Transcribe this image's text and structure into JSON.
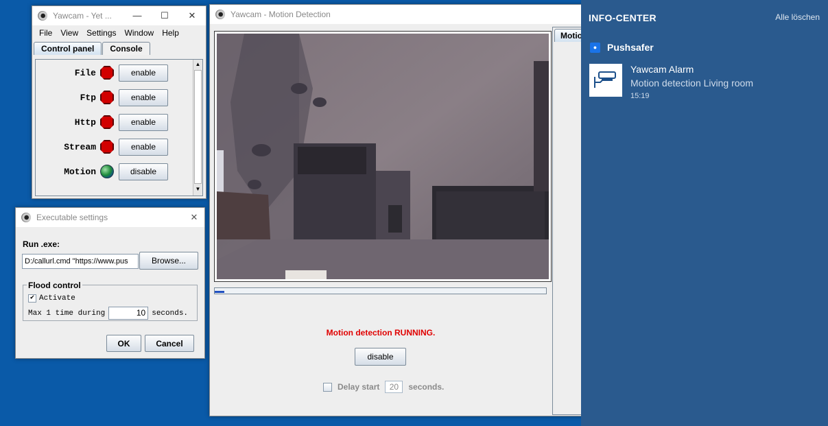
{
  "control_window": {
    "title": "Yawcam - Yet ...",
    "menu": [
      "File",
      "View",
      "Settings",
      "Window",
      "Help"
    ],
    "tabs": [
      "Control panel",
      "Console"
    ],
    "rows": [
      {
        "label": "File",
        "button": "enable",
        "status": "stop-icon"
      },
      {
        "label": "Ftp",
        "button": "enable",
        "status": "stop-icon"
      },
      {
        "label": "Http",
        "button": "enable",
        "status": "stop-icon"
      },
      {
        "label": "Stream",
        "button": "enable",
        "status": "stop-icon"
      },
      {
        "label": "Motion",
        "button": "disable",
        "status": "globe-icon"
      }
    ]
  },
  "exec_window": {
    "title": "Executable settings",
    "run_label": "Run .exe:",
    "run_value": "D:/callurl.cmd \"https://www.pus",
    "browse": "Browse...",
    "flood_title": "Flood control",
    "activate": "Activate",
    "max_prefix": "Max 1 time during",
    "max_value": "10",
    "max_suffix": "seconds.",
    "ok": "OK",
    "cancel": "Cancel"
  },
  "motion_window": {
    "title": "Yawcam - Motion Detection",
    "side_tab": "Motio",
    "status": "Motion detection RUNNING.",
    "status_color": "#e00000",
    "disable": "disable",
    "delay_label": "Delay start",
    "delay_value": "20",
    "delay_suffix": "seconds.",
    "progress": 0.03
  },
  "info_center": {
    "title": "INFO-CENTER",
    "clear_all": "Alle löschen",
    "app": "Pushsafer",
    "notification": {
      "title": "Yawcam Alarm",
      "body": "Motion detection Living room",
      "time": "15:19"
    }
  }
}
